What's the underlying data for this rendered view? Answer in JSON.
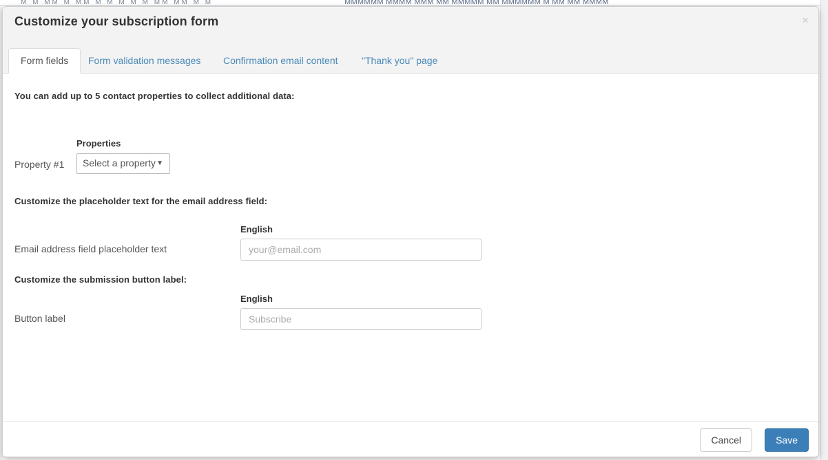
{
  "background": {
    "clipped_text_center": "MMMMMM MMMM MMM MM MMMMM MM MMMMMM M MM MM MMMM",
    "clipped_text_left": "M M MM M MM M M M M M MM MM M M"
  },
  "modal": {
    "title": "Customize your subscription form",
    "close_label": "×",
    "tabs": [
      {
        "label": "Form fields",
        "active": true
      },
      {
        "label": "Form validation messages",
        "active": false
      },
      {
        "label": "Confirmation email content",
        "active": false
      },
      {
        "label": "\"Thank you\" page",
        "active": false
      }
    ],
    "sections": {
      "properties": {
        "heading": "You can add up to 5 contact properties to collect additional data:",
        "column_header": "Properties",
        "row_label": "Property #1",
        "select_value": "Select a property",
        "select_caret": "▼"
      },
      "placeholder": {
        "heading": "Customize the placeholder text for the email address field:",
        "column_header": "English",
        "row_label": "Email address field placeholder text",
        "input_value": "",
        "input_placeholder": "your@email.com"
      },
      "button_label": {
        "heading": "Customize the submission button label:",
        "column_header": "English",
        "row_label": "Button label",
        "input_value": "",
        "input_placeholder": "Subscribe"
      }
    },
    "footer": {
      "cancel_label": "Cancel",
      "save_label": "Save"
    }
  },
  "colors": {
    "primary": "#3c7fb8",
    "tab_link": "#4a8ab8",
    "header_bg": "#f3f3f3",
    "border": "#dddddd",
    "text": "#333333"
  }
}
